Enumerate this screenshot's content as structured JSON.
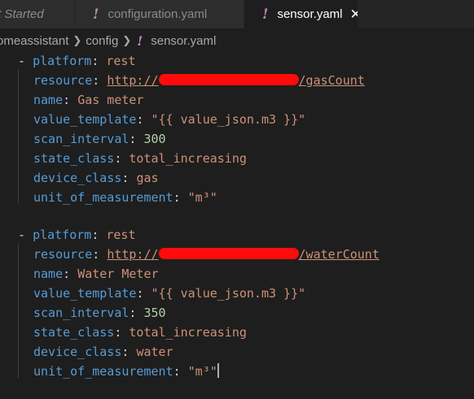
{
  "tabs": [
    {
      "label": "t Started"
    },
    {
      "label": "configuration.yaml",
      "icon": "exclamation-icon"
    },
    {
      "label": "sensor.yaml",
      "icon": "exclamation-icon",
      "close": "✕"
    }
  ],
  "breadcrumb": {
    "parts": [
      "omeassistant",
      "config",
      "sensor.yaml"
    ]
  },
  "sensors": [
    {
      "platform_key": "platform",
      "platform": "rest",
      "resource_key": "resource",
      "resource_prefix": "http://",
      "resource_suffix": "/gasCount",
      "name_key": "name",
      "name": "Gas meter",
      "value_template_key": "value_template",
      "value_template": "\"{{ value_json.m3 }}\"",
      "scan_interval_key": "scan_interval",
      "scan_interval": "300",
      "state_class_key": "state_class",
      "state_class": "total_increasing",
      "device_class_key": "device_class",
      "device_class": "gas",
      "unit_key": "unit_of_measurement",
      "unit": "\"m³\""
    },
    {
      "platform_key": "platform",
      "platform": "rest",
      "resource_key": "resource",
      "resource_prefix": "http://",
      "resource_suffix": "/waterCount",
      "name_key": "name",
      "name": "Water Meter",
      "value_template_key": "value_template",
      "value_template": "\"{{ value_json.m3 }}\"",
      "scan_interval_key": "scan_interval",
      "scan_interval": "350",
      "state_class_key": "state_class",
      "state_class": "total_increasing",
      "device_class_key": "device_class",
      "device_class": "water",
      "unit_key": "unit_of_measurement",
      "unit": "\"m³\""
    }
  ],
  "syntax": {
    "dash": "-",
    "colon": ":"
  },
  "colors": {
    "background": "#1e1e1e",
    "key": "#569cd6",
    "string": "#ce9178",
    "number": "#b5cea8",
    "yaml_icon": "#c586c0",
    "redaction": "#ff0b0b"
  }
}
